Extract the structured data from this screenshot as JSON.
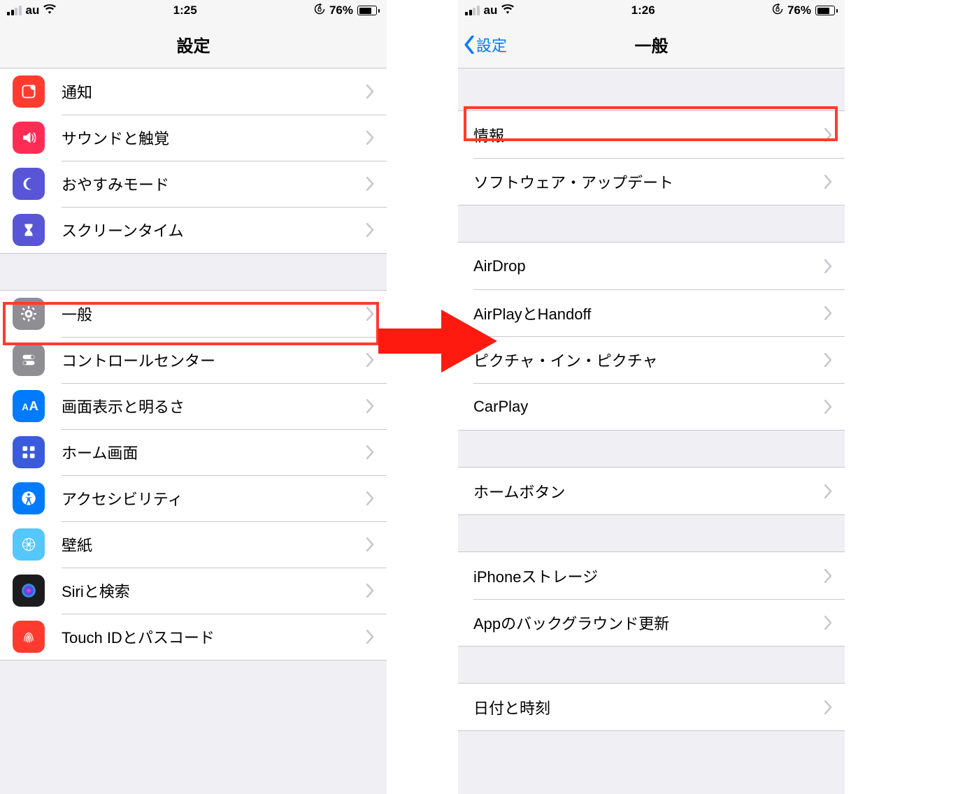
{
  "left": {
    "status": {
      "carrier": "au",
      "time": "1:25",
      "battery_pct": "76%"
    },
    "nav": {
      "title": "設定"
    },
    "group1": [
      {
        "label": "通知",
        "icon": "notifications-icon",
        "bg": "bg-red"
      },
      {
        "label": "サウンドと触覚",
        "icon": "sound-icon",
        "bg": "bg-pink"
      },
      {
        "label": "おやすみモード",
        "icon": "moon-icon",
        "bg": "bg-purple"
      },
      {
        "label": "スクリーンタイム",
        "icon": "hourglass-icon",
        "bg": "bg-indigo"
      }
    ],
    "group2": [
      {
        "label": "一般",
        "icon": "gear-icon",
        "bg": "bg-gray"
      },
      {
        "label": "コントロールセンター",
        "icon": "toggles-icon",
        "bg": "bg-gray"
      },
      {
        "label": "画面表示と明るさ",
        "icon": "text-size-icon",
        "bg": "bg-blue"
      },
      {
        "label": "ホーム画面",
        "icon": "home-apps-icon",
        "bg": "bg-homeicons"
      },
      {
        "label": "アクセシビリティ",
        "icon": "accessibility-icon",
        "bg": "bg-blue"
      },
      {
        "label": "壁紙",
        "icon": "wallpaper-icon",
        "bg": "bg-lightblue"
      },
      {
        "label": "Siriと検索",
        "icon": "siri-icon",
        "bg": "bg-black"
      },
      {
        "label": "Touch IDとパスコード",
        "icon": "fingerprint-icon",
        "bg": "bg-redfp"
      }
    ]
  },
  "right": {
    "status": {
      "carrier": "au",
      "time": "1:26",
      "battery_pct": "76%"
    },
    "nav": {
      "title": "一般",
      "back": "設定"
    },
    "grA": [
      "情報",
      "ソフトウェア・アップデート"
    ],
    "grB": [
      "AirDrop",
      "AirPlayとHandoff",
      "ピクチャ・イン・ピクチャ",
      "CarPlay"
    ],
    "grC": [
      "ホームボタン"
    ],
    "grD": [
      "iPhoneストレージ",
      "Appのバックグラウンド更新"
    ],
    "grE": [
      "日付と時刻"
    ]
  }
}
